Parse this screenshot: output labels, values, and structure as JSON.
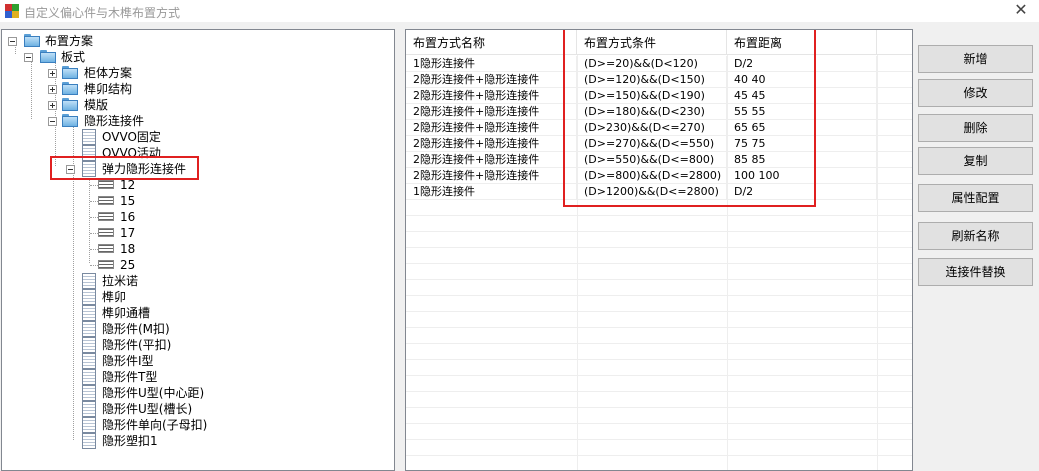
{
  "window": {
    "title": "自定义偏心件与木榫布置方式",
    "close": "✕"
  },
  "tree": {
    "root": "布置方案",
    "board_style": "板式",
    "cabinet_plan": "柜体方案",
    "mortise_structure": "榫卯结构",
    "template": "模版",
    "hidden_connector": "隐形连接件",
    "ovvo_fixed": "OVVO固定",
    "ovvo_active": "OVVO活动",
    "elastic_hidden_connector": "弹力隐形连接件",
    "elastic_children": [
      "12",
      "15",
      "16",
      "17",
      "18",
      "25"
    ],
    "others": [
      "拉米诺",
      "榫卯",
      "榫卯通槽",
      "隐形件(M扣)",
      "隐形件(平扣)",
      "隐形件I型",
      "隐形件T型",
      "隐形件U型(中心距)",
      "隐形件U型(槽长)",
      "隐形件单向(子母扣)",
      "隐形塑扣1"
    ]
  },
  "grid": {
    "headers": [
      "布置方式名称",
      "布置方式条件",
      "布置距离"
    ],
    "rows": [
      [
        "1隐形连接件",
        "(D>=20)&&(D<120)",
        "D/2"
      ],
      [
        "2隐形连接件+隐形连接件",
        "(D>=120)&&(D<150)",
        "40 40"
      ],
      [
        "2隐形连接件+隐形连接件",
        "(D>=150)&&(D<190)",
        "45 45"
      ],
      [
        "2隐形连接件+隐形连接件",
        "(D>=180)&&(D<230)",
        "55 55"
      ],
      [
        "2隐形连接件+隐形连接件",
        "(D>230)&&(D<=270)",
        "65 65"
      ],
      [
        "2隐形连接件+隐形连接件",
        "(D>=270)&&(D<=550)",
        "75 75"
      ],
      [
        "2隐形连接件+隐形连接件",
        "(D>=550)&&(D<=800)",
        "85 85"
      ],
      [
        "2隐形连接件+隐形连接件",
        "(D>=800)&&(D<=2800)",
        "100 100"
      ],
      [
        "1隐形连接件",
        "(D>1200)&&(D<=2800)",
        "D/2"
      ]
    ]
  },
  "buttons": {
    "add": "新增",
    "modify": "修改",
    "delete": "删除",
    "copy": "复制",
    "property_config": "属性配置",
    "refresh_name": "刷新名称",
    "connector_replace": "连接件替换"
  },
  "colors": {
    "highlight": "#e02020",
    "folder": "#6fb2e2"
  }
}
